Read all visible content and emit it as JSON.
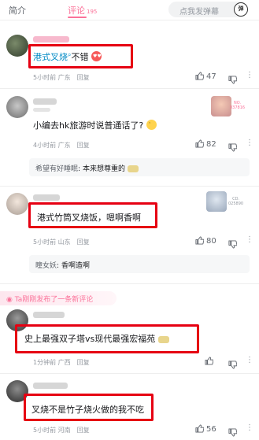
{
  "tabs": {
    "intro": "简介",
    "comment": "评论",
    "comment_count": "195"
  },
  "danmaku": {
    "placeholder": "点我发弹幕",
    "icon_label": "弹"
  },
  "comments": [
    {
      "text_main": "港式叉烧",
      "text_suffix": "不错",
      "time": "5小时前",
      "location": "广东",
      "reply_label": "回复",
      "likes": "47"
    },
    {
      "text": "小编去hk旅游时说普通话了?",
      "time": "4小时前",
      "location": "广东",
      "reply_label": "回复",
      "likes": "82",
      "badge_caption_1": "NO.",
      "badge_caption_2": "037816",
      "sub_reply": {
        "name": "希望有好睡眠",
        "sep": ":",
        "text": "本来想尊重的"
      }
    },
    {
      "text": "港式竹筒叉烧饭，嗯啊香啊",
      "time": "5小时前",
      "location": "山东",
      "reply_label": "回复",
      "likes": "80",
      "badge_caption_1": "CD.",
      "badge_caption_2": "025890",
      "sub_reply": {
        "name": "瞳女妖",
        "sep": ":",
        "text": "香啊造啊"
      }
    },
    {
      "text": "史上最强双子塔vs现代最强宏福苑",
      "time": "1分钟前",
      "location": "广西",
      "reply_label": "回复",
      "likes": ""
    },
    {
      "text": "叉烧不是竹子烧火做的我不吃",
      "time": "5小时前",
      "location": "河南",
      "reply_label": "回复",
      "likes": "56"
    }
  ],
  "new_comment_notice": "Ta刚刚发布了一条新评论",
  "colors": {
    "accent": "#fb7299",
    "highlight_box": "#e60012",
    "link_blue": "#008ac5"
  },
  "icons": [
    "thumbs-up-icon",
    "thumbs-down-icon",
    "more-dots-icon",
    "danmaku-icon",
    "plus-icon"
  ]
}
